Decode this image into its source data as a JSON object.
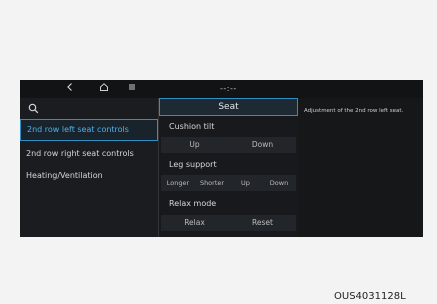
{
  "topbar": {
    "back_icon": "chevron-left-icon",
    "home_icon": "home-icon",
    "menu_icon": "menu-icon",
    "title": "--:--"
  },
  "left_panel": {
    "search_icon": "search-icon",
    "items": [
      {
        "label": "2nd row left seat controls",
        "active": true
      },
      {
        "label": "2nd row right seat controls",
        "active": false
      },
      {
        "label": "Heating/Ventilation",
        "active": false
      }
    ]
  },
  "middle_panel": {
    "header": "Seat",
    "sections": [
      {
        "title": "Cushion tilt",
        "buttons": [
          "Up",
          "Down"
        ]
      },
      {
        "title": "Leg support",
        "buttons": [
          "Longer",
          "Shorter",
          "Up",
          "Down"
        ]
      },
      {
        "title": "Relax mode",
        "buttons": [
          "Relax",
          "Reset"
        ]
      }
    ]
  },
  "right_panel": {
    "description": "Adjustment of the 2nd row left seat."
  },
  "figure_code": "OUS4031128L",
  "colors": {
    "accent": "#2f8fc2",
    "screen_bg": "#151719"
  }
}
